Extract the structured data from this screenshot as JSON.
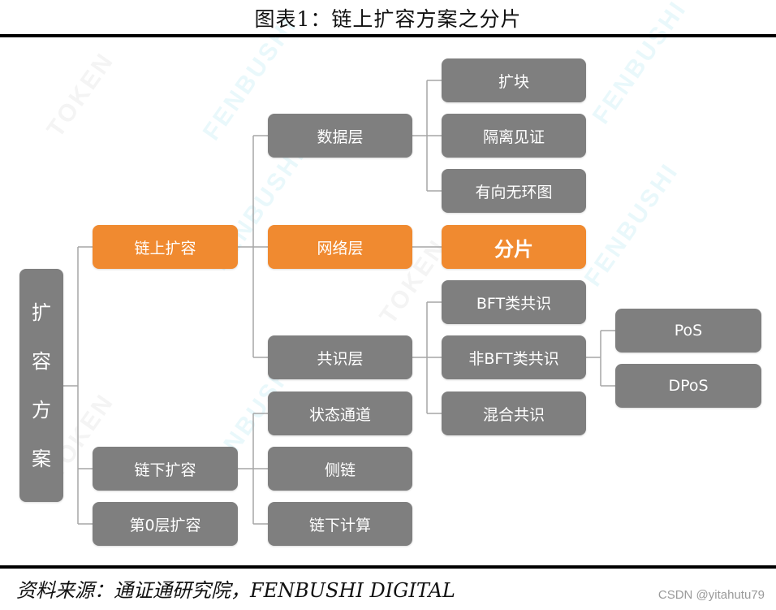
{
  "title": "图表1：链上扩容方案之分片",
  "source": "资料来源：通证通研究院，FENBUSHI DIGITAL",
  "credit": "CSDN @yitahutu79",
  "colors": {
    "node_gray": "#7f7f7f",
    "node_highlight": "#f08a30",
    "connector": "#a6a6a6",
    "text": "#ffffff"
  },
  "watermarks": [
    "TOKEN",
    "FENBUSHI",
    "FENBUSHI",
    "TOKEN",
    "FENBUSHI",
    "FENBUSHI",
    "TOKEN",
    "FENBUSHI"
  ],
  "tree": {
    "root": {
      "label_chars": [
        "扩",
        "容",
        "方",
        "案"
      ]
    },
    "level1": [
      {
        "label": "链上扩容",
        "highlight": true
      },
      {
        "label": "链下扩容",
        "highlight": false
      },
      {
        "label": "第0层扩容",
        "highlight": false
      }
    ],
    "onchain_layers": [
      {
        "label": "数据层",
        "highlight": false
      },
      {
        "label": "网络层",
        "highlight": true
      },
      {
        "label": "共识层",
        "highlight": false
      }
    ],
    "offchain_items": [
      {
        "label": "状态通道"
      },
      {
        "label": "侧链"
      },
      {
        "label": "链下计算"
      }
    ],
    "data_layer_items": [
      {
        "label": "扩块"
      },
      {
        "label": "隔离见证"
      },
      {
        "label": "有向无环图"
      }
    ],
    "network_layer_items": [
      {
        "label": "分片",
        "highlight": true
      }
    ],
    "consensus_layer_items": [
      {
        "label": "BFT类共识"
      },
      {
        "label": "非BFT类共识"
      },
      {
        "label": "混合共识"
      }
    ],
    "non_bft_items": [
      {
        "label": "PoS"
      },
      {
        "label": "DPoS"
      }
    ]
  }
}
